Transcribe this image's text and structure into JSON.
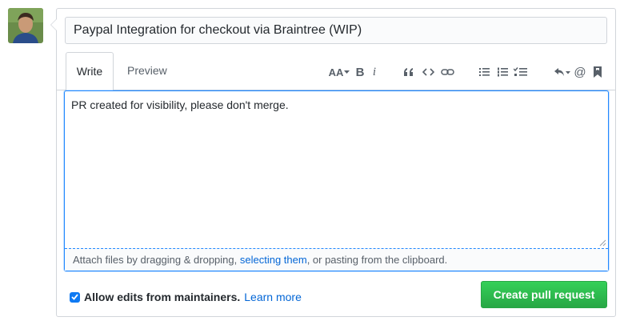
{
  "pull_request": {
    "title_value": "Paypal Integration for checkout via Braintree (WIP)",
    "body_value": "PR created for visibility, please don't merge."
  },
  "tabs": {
    "write_label": "Write",
    "preview_label": "Preview"
  },
  "toolbar": {
    "icons": [
      "text-size-icon",
      "bold-icon",
      "italic-icon",
      "quote-icon",
      "code-icon",
      "link-icon",
      "bullet-list-icon",
      "numbered-list-icon",
      "task-list-icon",
      "reply-icon",
      "mention-icon",
      "bookmark-icon"
    ],
    "text_size_label": "AA",
    "bold_label": "B",
    "italic_label": "i",
    "mention_label": "@"
  },
  "attach": {
    "prefix": "Attach files by dragging & dropping, ",
    "link": "selecting them",
    "suffix": ", or pasting from the clipboard."
  },
  "maintainers": {
    "checked": true,
    "label": "Allow edits from maintainers.",
    "learn_more": "Learn more"
  },
  "actions": {
    "create_label": "Create pull request"
  },
  "colors": {
    "link": "#0366d6",
    "focus": "#2188ff",
    "primary_button": "#28a745"
  }
}
